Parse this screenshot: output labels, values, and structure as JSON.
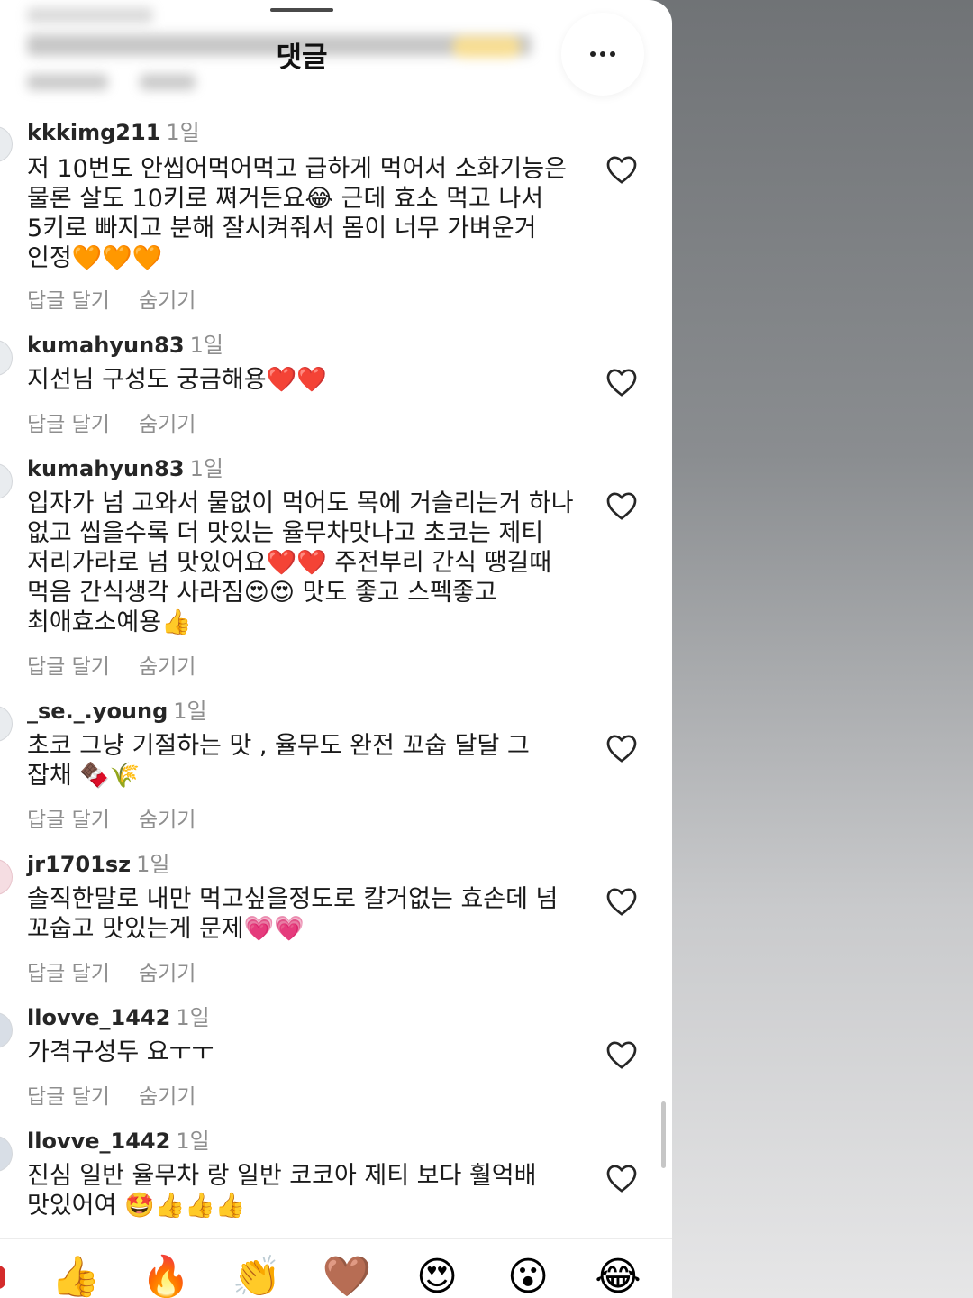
{
  "sheet": {
    "title": "댓글",
    "more_label": "···"
  },
  "actions": {
    "reply": "답글 달기",
    "hide": "숨기기"
  },
  "comments": [
    {
      "username": "kkkimg211",
      "time": "1일",
      "text": "저 10번도 안씹어먹어먹고 급하게 먹어서 소화기능은 물론 살도 10키로 쪄거든요😂 근데 효소 먹고 나서 5키로 빠지고 분해 잘시켜줘서 몸이 너무 가벼운거 인정🧡🧡🧡"
    },
    {
      "username": "kumahyun83",
      "time": "1일",
      "text": "지선님 구성도 궁금해용❤️❤️"
    },
    {
      "username": "kumahyun83",
      "time": "1일",
      "text": "입자가 넘 고와서 물없이 먹어도 목에 거슬리는거 하나 없고 씹을수록 더 맛있는 율무차맛나고 초코는 제티 저리가라로 넘 맛있어요❤️❤️ 주전부리 간식 땡길때 먹음 간식생각 사라짐😍😍 맛도 좋고 스펙좋고 최애효소예용👍"
    },
    {
      "username": "_se._.young",
      "time": "1일",
      "text": "초코 그냥 기절하는 맛 , 율무도 완전 꼬숩 달달 그 잡채 🍫🌾"
    },
    {
      "username": "jr1701sz",
      "time": "1일",
      "text": "솔직한말로 내만 먹고싶을정도로 칼거없는 효손데 넘 꼬숩고 맛있는게 문제💗💗"
    },
    {
      "username": "llovve_1442",
      "time": "1일",
      "text": "가격구성두 요ㅜㅜ"
    },
    {
      "username": "llovve_1442",
      "time": "1일",
      "text": "진심 일반 율무차 랑 일반 코코아 제티 보다 훨억배 맛있어여 🤩👍👍👍"
    }
  ],
  "reactions": [
    "👍",
    "🔥",
    "👏",
    "🤎",
    "😍",
    "😮",
    "😂"
  ]
}
